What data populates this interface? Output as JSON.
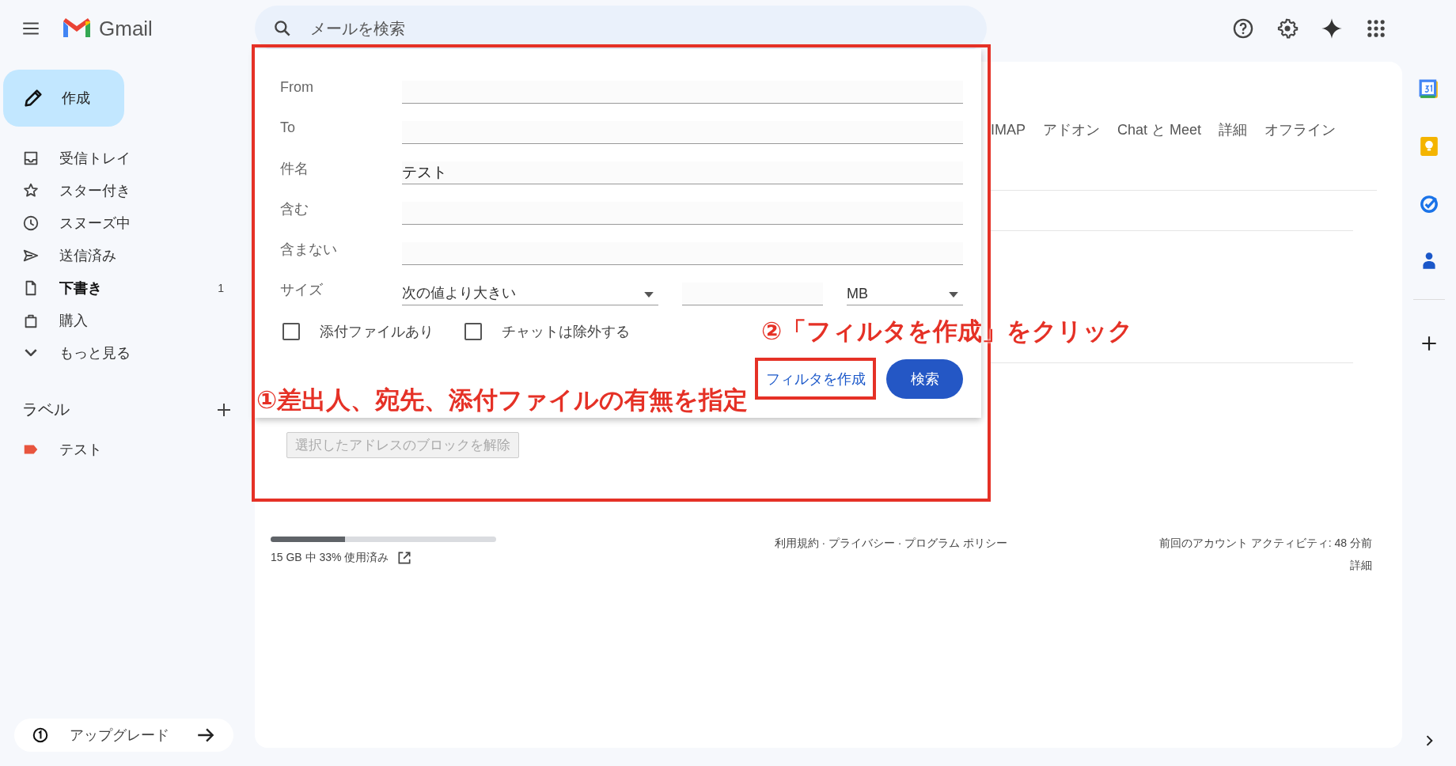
{
  "header": {
    "logo": "Gmail",
    "search": {
      "placeholder": "メールを検索"
    }
  },
  "compose": "作成",
  "nav": [
    {
      "label": "受信トレイ",
      "bold": false
    },
    {
      "label": "スター付き",
      "bold": false
    },
    {
      "label": "スヌーズ中",
      "bold": false
    },
    {
      "label": "送信済み",
      "bold": false
    },
    {
      "label": "下書き",
      "bold": true,
      "count": "1"
    },
    {
      "label": "購入",
      "bold": false
    },
    {
      "label": "もっと見る",
      "bold": false
    }
  ],
  "labels": {
    "title": "ラベル",
    "items": [
      {
        "name": "テスト",
        "color": "#e8553e"
      }
    ]
  },
  "upgrade": "アップグレード",
  "settings_tabs": [
    {
      "label": "IMAP"
    },
    {
      "label": "アドオン"
    },
    {
      "label": "Chat と Meet"
    },
    {
      "label": "詳細"
    },
    {
      "label": "オフライン"
    }
  ],
  "filter_dialog": {
    "fields": [
      {
        "label": "From"
      },
      {
        "label": "To"
      },
      {
        "label": "件名",
        "value": "テスト"
      },
      {
        "label": "含む"
      },
      {
        "label": "含まない"
      }
    ],
    "size": {
      "label": "サイズ",
      "operator": "次の値より大きい",
      "unit": "MB"
    },
    "checkboxes": [
      {
        "label": "添付ファイルあり",
        "checked": false
      },
      {
        "label": "チャットは除外する",
        "checked": false
      }
    ],
    "create_filter": "フィルタを作成",
    "search": "検索"
  },
  "unblock_button": {
    "label": "選択したアドレスのブロックを解除",
    "disabled": true
  },
  "annotations": [
    {
      "text": "①差出人、宛先、添付ファイルの有無を指定"
    },
    {
      "text": "②「フィルタを作成」をクリック"
    }
  ],
  "footer": {
    "storage": {
      "level": 0.33,
      "text": "15 GB 中 33% 使用済み"
    },
    "links": "利用規約 · プライバシー · プログラム ポリシー",
    "activity": "前回のアカウント アクティビティ: 48 分前",
    "details": "詳細"
  }
}
